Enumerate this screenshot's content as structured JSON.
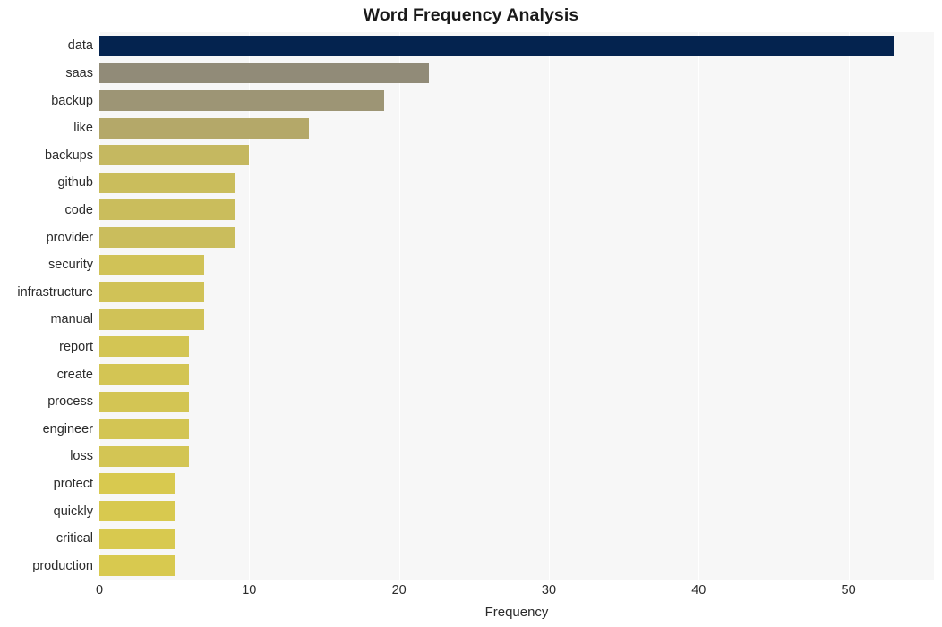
{
  "chart_data": {
    "type": "bar",
    "orientation": "horizontal",
    "title": "Word Frequency Analysis",
    "xlabel": "Frequency",
    "ylabel": "",
    "xlim": [
      0,
      55.7
    ],
    "xticks": [
      0,
      10,
      20,
      30,
      40,
      50
    ],
    "xtick_labels": [
      "0",
      "10",
      "20",
      "30",
      "40",
      "50"
    ],
    "grid": true,
    "grid_axis": "x",
    "legend": false,
    "categories": [
      "data",
      "saas",
      "backup",
      "like",
      "backups",
      "github",
      "code",
      "provider",
      "security",
      "infrastructure",
      "manual",
      "report",
      "create",
      "process",
      "engineer",
      "loss",
      "protect",
      "quickly",
      "critical",
      "production"
    ],
    "values": [
      53,
      22,
      19,
      14,
      10,
      9,
      9,
      9,
      7,
      7,
      7,
      6,
      6,
      6,
      6,
      6,
      5,
      5,
      5,
      5
    ],
    "bar_colors": [
      "#04234f",
      "#918b78",
      "#9d9575",
      "#b4a869",
      "#c5b860",
      "#cabd5c",
      "#cabd5c",
      "#cabd5c",
      "#d0c257",
      "#d0c257",
      "#d0c257",
      "#d3c554",
      "#d3c554",
      "#d3c554",
      "#d3c554",
      "#d3c554",
      "#d8c94f",
      "#d8c94f",
      "#d8c94f",
      "#d8c94f"
    ],
    "plot_background": "#f7f7f7",
    "figure_background": "#ffffff",
    "gridline_color": "#ffffff",
    "text_color": "#2b2b2b"
  }
}
